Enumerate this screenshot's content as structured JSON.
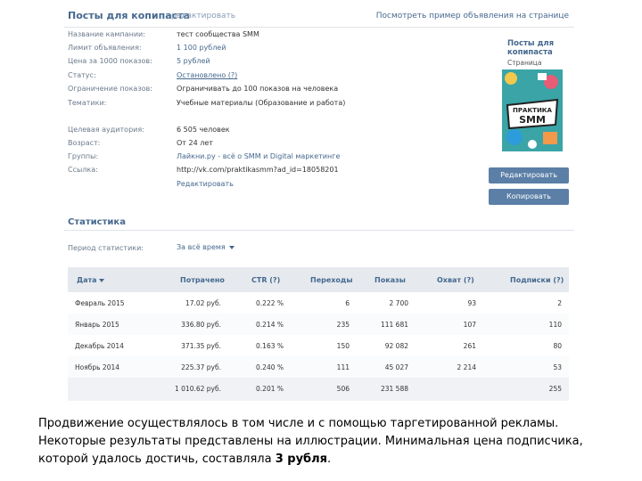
{
  "header": {
    "title": "Посты для копипаста",
    "edit": "редактировать",
    "preview_link": "Посмотреть пример объявления на странице"
  },
  "info": [
    {
      "label": "Название кампании:",
      "value": "тест сообщества SMM",
      "style": "plain"
    },
    {
      "label": "Лимит объявления:",
      "value": "1 100 рублей",
      "style": "link"
    },
    {
      "label": "Цена за 1000 показов:",
      "value": "5 рублей",
      "style": "link"
    },
    {
      "label": "Статус:",
      "value": "Остановлено (?)",
      "style": "underline"
    },
    {
      "label": "Ограничение показов:",
      "value": "Ограничивать до 100 показов на человека",
      "style": "plain"
    },
    {
      "label": "Тематики:",
      "value": "Учебные материалы (Образование и работа)",
      "style": "plain"
    },
    {
      "label": "Целевая аудитория:",
      "value": "6 505 человек",
      "style": "plain"
    },
    {
      "label": "Возраст:",
      "value": "От 24 лет",
      "style": "plain"
    },
    {
      "label": "Группы:",
      "value": "Лайкни.ру - всё о SMM и Digital маркетинге",
      "style": "link"
    },
    {
      "label": "Ссылка:",
      "value": "http://vk.com/praktikasmm?ad_id=18058201",
      "style": "plain"
    },
    {
      "label": "",
      "value": "Редактировать",
      "style": "link"
    }
  ],
  "ad": {
    "title": "Посты для копипаста",
    "subtitle": "Страница",
    "image_text": "ПРАКТИКА SMM"
  },
  "buttons": {
    "edit": "Редактировать",
    "copy": "Копировать"
  },
  "stats": {
    "title": "Статистика",
    "period_label": "Период статистики:",
    "period_value": "За всё время"
  },
  "table": {
    "headers": [
      "Дата",
      "Потрачено",
      "CTR (?)",
      "Переходы",
      "Показы",
      "Охват (?)",
      "Подписки (?)"
    ],
    "rows": [
      [
        "Февраль 2015",
        "17.02 руб.",
        "0.222 %",
        "6",
        "2 700",
        "93",
        "2"
      ],
      [
        "Январь 2015",
        "336.80 руб.",
        "0.214 %",
        "235",
        "111 681",
        "107",
        "110"
      ],
      [
        "Декабрь 2014",
        "371.35 руб.",
        "0.163 %",
        "150",
        "92 082",
        "261",
        "80"
      ],
      [
        "Ноябрь 2014",
        "225.37 руб.",
        "0.240 %",
        "111",
        "45 027",
        "2 214",
        "53"
      ]
    ],
    "total": [
      "",
      "1 010.62 руб.",
      "0.201 %",
      "506",
      "231 588",
      "",
      "255"
    ]
  },
  "caption": {
    "text": "Продвижение осуществлялось в том числе и с помощью таргетированной рекламы. Некоторые результаты представлены на иллюстрации. Минимальная цена подписчика, которой удалось достичь, составляла ",
    "bold": "3 рубля",
    "end": "."
  },
  "colors": {
    "link": "#45688e",
    "button": "#5b7fa6",
    "table_header": "#e6eaef"
  }
}
